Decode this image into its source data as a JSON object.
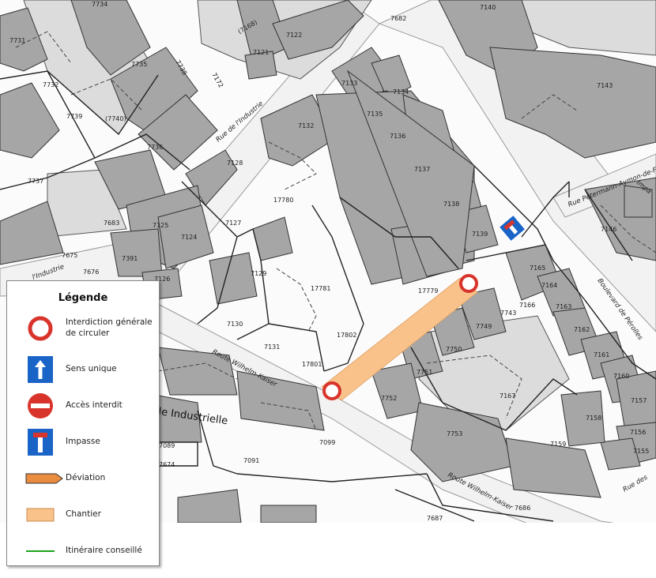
{
  "legend": {
    "title": "Légende",
    "items": [
      {
        "label": "Interdiction générale de circuler",
        "icon": "no-traffic-sign-icon"
      },
      {
        "label": "Sens unique",
        "icon": "one-way-sign-icon"
      },
      {
        "label": "Accès interdit",
        "icon": "no-entry-sign-icon"
      },
      {
        "label": "Impasse",
        "icon": "dead-end-sign-icon"
      },
      {
        "label": "Déviation",
        "icon": "detour-arrow-icon"
      },
      {
        "label": "Chantier",
        "icon": "construction-zone-icon"
      },
      {
        "label": "Itinéraire conseillé",
        "icon": "recommended-route-icon"
      }
    ]
  },
  "streets": {
    "industrie": "Rue de l'Industrie",
    "industrie_partial": "l'Industrie",
    "industrie_big": "le Industrielle",
    "wilhelm_kaiser": "Route Wilhelm-Kaiser",
    "perolles": "Boulevard de Pérolles",
    "peterman": "Rue Petermann-Aymon-de-Faucigny",
    "impasse_partial": "Impa",
    "rue_des": "Rue des"
  },
  "parcels": {
    "p7734": "7734",
    "p7731": "7731",
    "p7732": "7732",
    "p7739": "7739",
    "p7740": "(7740)",
    "p7735": "7735",
    "p7736": "7736",
    "p7738": "7738",
    "p7172": "7172",
    "p7168": "(7168)",
    "p7121": "7121",
    "p7122": "7122",
    "p7682": "7682",
    "p7140": "7140",
    "p7143": "7143",
    "p7133": "7133",
    "p7134": "7134",
    "p7135": "7135",
    "p7136": "7136",
    "p7132": "7132",
    "p7737": "7737",
    "p7128": "7128",
    "p7137": "7137",
    "p17780": "17780",
    "p7138": "7138",
    "p7139": "7139",
    "p7146": "7146",
    "p7683": "7683",
    "p7125": "7125",
    "p7124": "7124",
    "p7127": "7127",
    "p7675": "7675",
    "p7391": "7391",
    "p7676": "7676",
    "p7126": "7126",
    "p7129": "7129",
    "p17781": "17781",
    "p17779": "17779",
    "p7165": "7165",
    "p7164": "7164",
    "p7163": "7163",
    "p7166": "7166",
    "p7743": "7743",
    "p7749": "7749",
    "p7130": "7130",
    "p17802": "17802",
    "p7131": "7131",
    "p7750": "7750",
    "p7162": "7162",
    "p7161": "7161",
    "p17801": "17801",
    "p7751": "7751",
    "p7160": "7160",
    "p7752": "7752",
    "p7167": "7167",
    "p7157": "7157",
    "p7158": "7158",
    "p7156": "7156",
    "p7753": "7753",
    "p7099": "7099",
    "p7089": "7089",
    "p7159": "7159",
    "p7155": "7155",
    "p7674": "7674",
    "p7091": "7091",
    "p7686": "7686",
    "p7687": "7687"
  },
  "colors": {
    "building": "#a6a6a6",
    "building_light": "#d9d9d9",
    "road": "#f4f4f4",
    "construction": "#f9c28b",
    "no_traffic_red": "#d9342b",
    "sign_blue": "#1a64c8",
    "detour_orange": "#e98c3f",
    "route_green": "#1aa31a"
  }
}
